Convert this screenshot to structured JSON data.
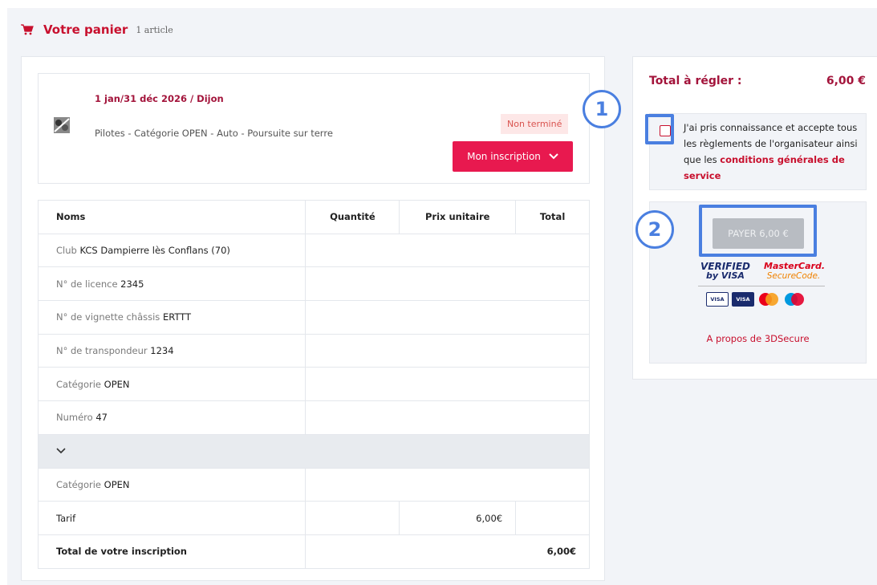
{
  "cart": {
    "title": "Votre panier",
    "count": "1 article"
  },
  "event": {
    "date_location": "1 jan/31 déc 2026 / Dijon",
    "description": "Pilotes - Catégorie OPEN - Auto - Poursuite sur terre",
    "status": "Non terminé",
    "inscription_button": "Mon inscription"
  },
  "table": {
    "headers": {
      "names": "Noms",
      "quantity": "Quantité",
      "unit_price": "Prix unitaire",
      "total": "Total"
    },
    "rows": [
      {
        "label": "Club",
        "value": "KCS Dampierre lès Conflans (70)"
      },
      {
        "label": "N° de licence",
        "value": "2345"
      },
      {
        "label": "N° de vignette châssis",
        "value": "ERTTT"
      },
      {
        "label": "N° de transpondeur",
        "value": "1234"
      },
      {
        "label": "Catégorie",
        "value": "OPEN"
      },
      {
        "label": "Numéro",
        "value": "47"
      }
    ],
    "category_row": {
      "label": "Catégorie",
      "value": "OPEN"
    },
    "tarif_row": {
      "label": "Tarif",
      "unit_price": "6,00€"
    },
    "total_row": {
      "label": "Total de votre inscription",
      "value": "6,00€"
    }
  },
  "payment": {
    "total_label": "Total à régler :",
    "total_value": "6,00 €",
    "terms_text": "J'ai pris connaissance et accepte tous les règlements de l'organisateur ainsi que les",
    "terms_link": "conditions générales de service",
    "pay_button": "PAYER 6,00 €",
    "verified_line1": "VERIFIED",
    "verified_line2": "by VISA",
    "mc_line1": "MasterCard.",
    "mc_line2": "SecureCode.",
    "card_visa": "VISA",
    "card_electron": "VISA",
    "secure_link": "A propos de 3DSecure"
  },
  "annotations": {
    "one": "1",
    "two": "2"
  },
  "colors": {
    "accent": "#e8194f",
    "brand_text": "#a3143b",
    "annotation": "#4a7fe0"
  }
}
